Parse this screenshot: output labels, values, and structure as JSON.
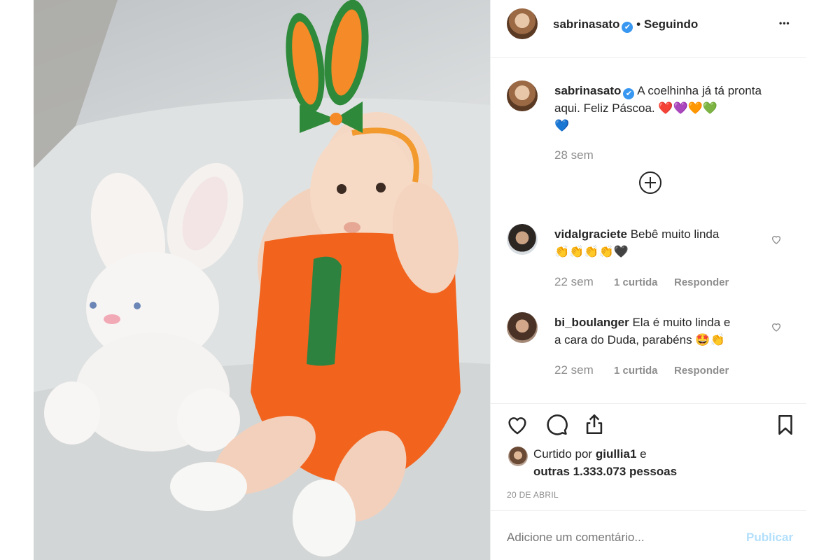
{
  "post": {
    "author": "sabrinasato",
    "separator": "•",
    "following_label": "Seguindo",
    "more_label": "•••",
    "caption": "A coelhinha já tá pronta aqui. Feliz Páscoa.",
    "caption_emoji_line1": "❤️💜🧡💚",
    "caption_emoji_line2": "💙",
    "caption_age": "28 sem",
    "load_more_label": "⊕"
  },
  "comments": [
    {
      "username": "vidalgraciete",
      "text": "Bebê muito linda",
      "emoji": "👏👏👏👏🖤",
      "age": "22 sem",
      "likes": "1 curtida",
      "reply": "Responder"
    },
    {
      "username": "bi_boulanger",
      "text": "Ela é muito linda e",
      "text2": "a cara do Duda, parabéns",
      "emoji": "🤩👏",
      "age": "22 sem",
      "likes": "1 curtida",
      "reply": "Responder"
    }
  ],
  "likes": {
    "prefix": "Curtido por",
    "user": "giullia1",
    "suffix": "e",
    "others": "outras 1.333.073 pessoas"
  },
  "date": "20 DE ABRIL",
  "comment_input": {
    "placeholder": "Adicione um comentário...",
    "publish_label": "Publicar"
  },
  "icons": {
    "like": "heart-icon",
    "comment": "comment-icon",
    "share": "share-icon",
    "save": "bookmark-icon",
    "verified": "verified-badge-icon"
  },
  "colors": {
    "verified": "#3897f0",
    "publish_disabled": "#b2dffc",
    "muted_text": "#8e8e8e"
  }
}
